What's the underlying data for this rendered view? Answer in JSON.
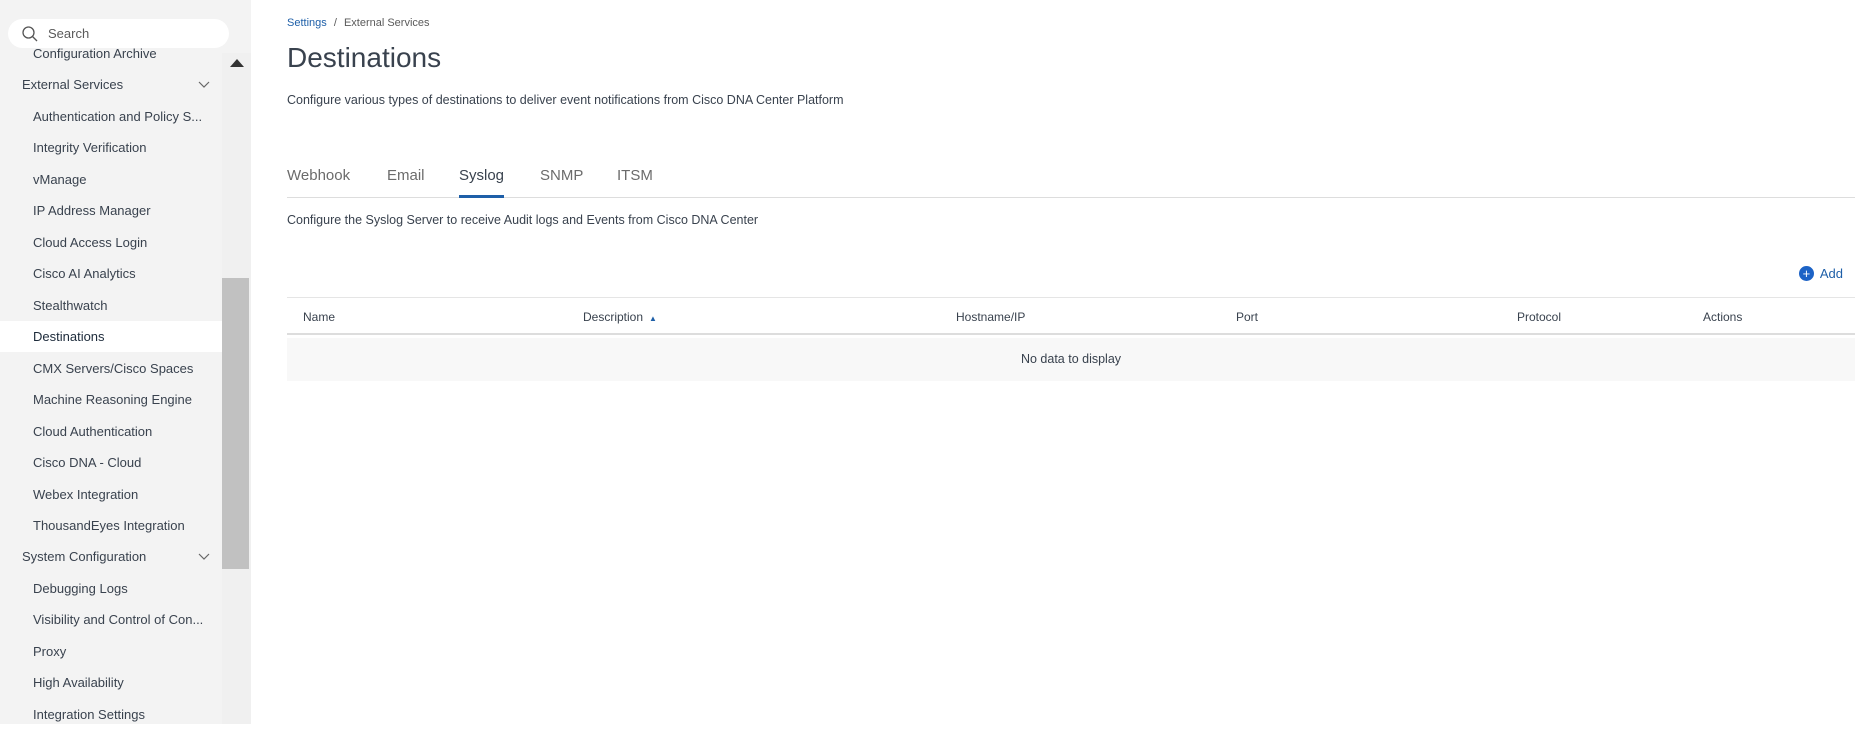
{
  "sidebar": {
    "search_placeholder": "Search",
    "items": [
      {
        "label": "Configuration Archive",
        "type": "sub"
      },
      {
        "label": "External Services",
        "type": "group"
      },
      {
        "label": "Authentication and Policy S...",
        "type": "sub"
      },
      {
        "label": "Integrity Verification",
        "type": "sub"
      },
      {
        "label": "vManage",
        "type": "sub"
      },
      {
        "label": "IP Address Manager",
        "type": "sub"
      },
      {
        "label": "Cloud Access Login",
        "type": "sub"
      },
      {
        "label": "Cisco AI Analytics",
        "type": "sub"
      },
      {
        "label": "Stealthwatch",
        "type": "sub"
      },
      {
        "label": "Destinations",
        "type": "sub",
        "selected": true
      },
      {
        "label": "CMX Servers/Cisco Spaces",
        "type": "sub"
      },
      {
        "label": "Machine Reasoning Engine",
        "type": "sub"
      },
      {
        "label": "Cloud Authentication",
        "type": "sub"
      },
      {
        "label": "Cisco DNA - Cloud",
        "type": "sub"
      },
      {
        "label": "Webex Integration",
        "type": "sub"
      },
      {
        "label": "ThousandEyes Integration",
        "type": "sub"
      },
      {
        "label": "System Configuration",
        "type": "group"
      },
      {
        "label": "Debugging Logs",
        "type": "sub"
      },
      {
        "label": "Visibility and Control of Con...",
        "type": "sub"
      },
      {
        "label": "Proxy",
        "type": "sub"
      },
      {
        "label": "High Availability",
        "type": "sub"
      },
      {
        "label": "Integration Settings",
        "type": "sub"
      }
    ]
  },
  "breadcrumb": {
    "link": "Settings",
    "sep": "/",
    "current": "External Services"
  },
  "title": "Destinations",
  "description": "Configure various types of destinations to deliver event notifications from Cisco DNA Center Platform",
  "tabs": [
    "Webhook",
    "Email",
    "Syslog",
    "SNMP",
    "ITSM"
  ],
  "active_tab": "Syslog",
  "syslog_description": "Configure the Syslog Server to receive Audit logs and Events from Cisco DNA Center",
  "add_label": "Add",
  "table": {
    "columns": [
      "Name",
      "Description",
      "Hostname/IP",
      "Port",
      "Protocol",
      "Actions"
    ],
    "sort_indicator": "▲",
    "empty": "No data to display"
  },
  "colors": {
    "accent": "#1e5fa8"
  }
}
